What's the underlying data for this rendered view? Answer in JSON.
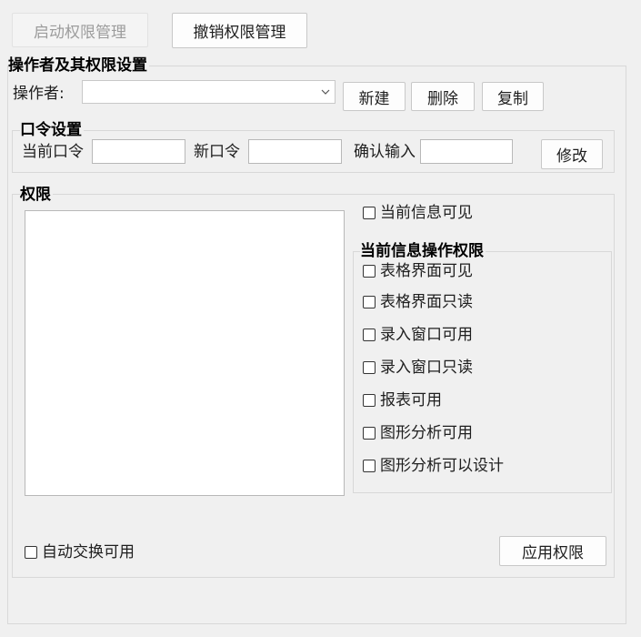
{
  "toolbar": {
    "enable_button": "启动权限管理",
    "revoke_button": "撤销权限管理"
  },
  "operator_group": {
    "title": "操作者及其权限设置",
    "operator_label": "操作者:",
    "operator_value": "",
    "new_button": "新建",
    "delete_button": "删除",
    "copy_button": "复制"
  },
  "password_group": {
    "title": "口令设置",
    "current_label": "当前口令",
    "current_value": "",
    "new_label": "新口令",
    "new_value": "",
    "confirm_label": "确认输入",
    "confirm_value": "",
    "modify_button": "修改"
  },
  "permission_group": {
    "title": "权限",
    "current_info_visible": "当前信息可见",
    "ops_group_title": "当前信息操作权限",
    "ops": [
      "表格界面可见",
      "表格界面只读",
      "录入窗口可用",
      "录入窗口只读",
      "报表可用",
      "图形分析可用",
      "图形分析可以设计"
    ],
    "auto_exchange": "自动交换可用",
    "apply_button": "应用权限"
  },
  "icons": {
    "combo_arrow": "chevron-down-icon"
  }
}
